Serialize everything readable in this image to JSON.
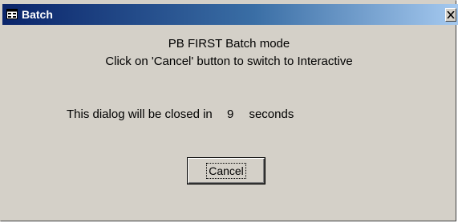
{
  "window": {
    "title": "Batch",
    "icon": "form-icon",
    "close_glyph": "×"
  },
  "message": {
    "line1": "PB FIRST Batch mode",
    "line2": "Click on 'Cancel' button to switch to Interactive"
  },
  "countdown": {
    "prefix": "This dialog will be closed in",
    "value": "9",
    "suffix": "seconds"
  },
  "buttons": {
    "cancel_label": "Cancel"
  },
  "colors": {
    "title_gradient_start": "#0a246a",
    "title_gradient_end": "#a6caf0",
    "dialog_face": "#d4d0c8"
  }
}
